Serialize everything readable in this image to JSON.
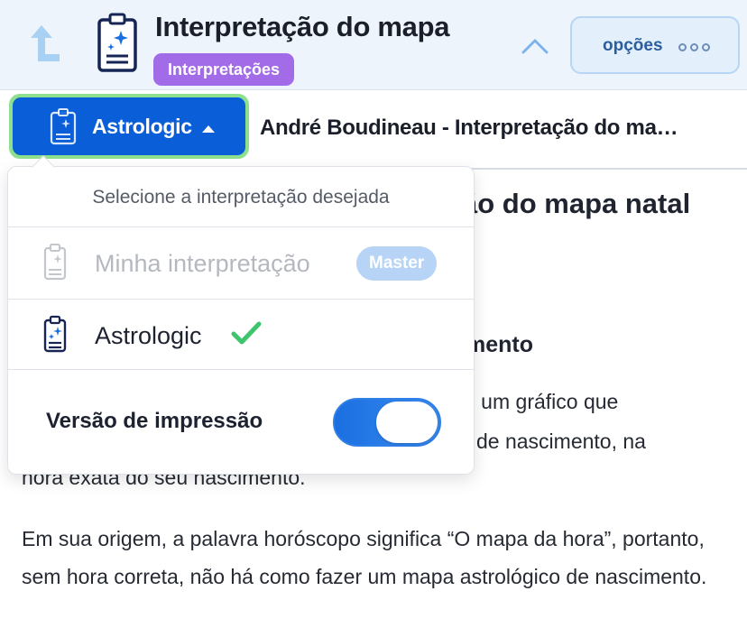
{
  "header": {
    "title": "Interpretação do mapa",
    "badge": "Interpretações",
    "options_label": "opções",
    "back_icon": "back-arrow-icon",
    "doc_icon": "document-sparkle-icon",
    "collapse_icon": "chevron-up-icon",
    "more_icon": "more-dots-icon"
  },
  "source": {
    "selected_label": "Astrologic",
    "icon": "document-sparkle-icon"
  },
  "document": {
    "title": "André Boudineau - Interpretação do ma…"
  },
  "dropdown": {
    "heading": "Selecione a interpretação desejada",
    "items": [
      {
        "label": "Minha interpretação",
        "badge": "Master",
        "enabled": false,
        "selected": false
      },
      {
        "label": "Astrologic",
        "enabled": true,
        "selected": true
      }
    ],
    "print_version": {
      "label": "Versão de impressão",
      "on": true
    }
  },
  "article": {
    "heading_visible": "ão do mapa natal",
    "subheading_visible": "mento",
    "para1_line1_visible": "e um gráfico que",
    "para1_line2_visible": "de nascimento, na",
    "para1_line3": "hora exata do seu nascimento.",
    "para2": "Em sua origem, a palavra horóscopo significa “O mapa da hora”, portanto, sem hora correta, não há como fazer um mapa astrológico de nascimento."
  },
  "colors": {
    "accent_blue": "#0a5fd8",
    "badge_purple": "#a26be8",
    "check_green": "#3ec46d",
    "focus_green": "#8ee08e",
    "header_bg": "#eef4fb"
  }
}
